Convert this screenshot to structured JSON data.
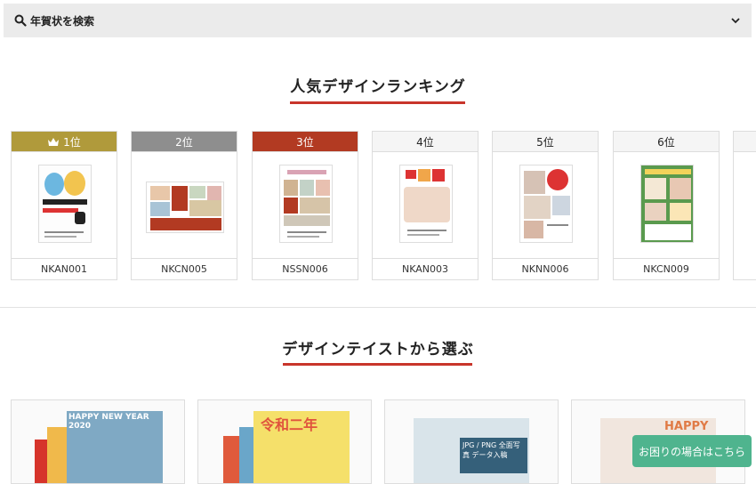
{
  "search": {
    "label": "年賀状を検索"
  },
  "ranking": {
    "title": "人気デザインランキング",
    "items": [
      {
        "rank": "1位",
        "code": "NKAN001",
        "color": "#b09a3b",
        "crown": true
      },
      {
        "rank": "2位",
        "code": "NKCN005",
        "color": "#8e8e8e",
        "crown": false
      },
      {
        "rank": "3位",
        "code": "NSSN006",
        "color": "#b23a22",
        "crown": false
      },
      {
        "rank": "4位",
        "code": "NKAN003",
        "color": "#f5f5f5",
        "crown": false
      },
      {
        "rank": "5位",
        "code": "NKNN006",
        "color": "#f5f5f5",
        "crown": false
      },
      {
        "rank": "6位",
        "code": "NKCN009",
        "color": "#f5f5f5",
        "crown": false
      }
    ]
  },
  "taste": {
    "title": "デザインテイストから選ぶ",
    "items": [
      {
        "thumb_text": "HAPPY NEW YEAR 2020"
      },
      {
        "thumb_text": "令和二年"
      },
      {
        "thumb_text": "JPG / PNG 全面写真 データ入稿"
      },
      {
        "thumb_text": "HAPPY"
      }
    ]
  },
  "help": {
    "label": "お困りの場合はこちら"
  }
}
